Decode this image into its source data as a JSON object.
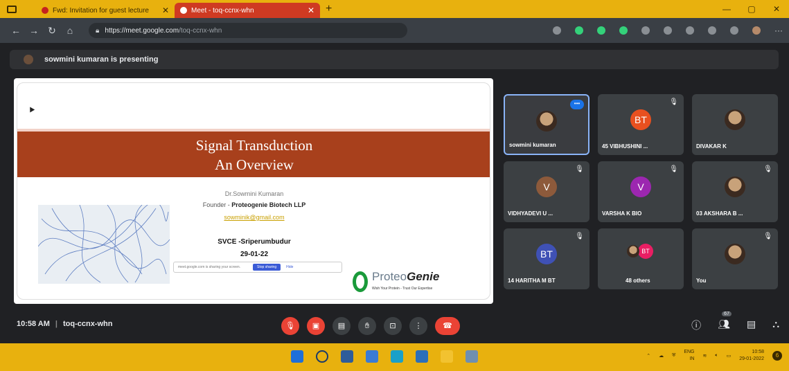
{
  "browser": {
    "tabs": [
      {
        "title": "Fwd: Invitation for guest lecture",
        "active": false
      },
      {
        "title": "Meet - toq-ccnx-whn",
        "active": true
      }
    ],
    "url_domain": "https://meet.google.com",
    "url_path": "/toq-ccnx-whn"
  },
  "meet": {
    "presenting_text": "sowmini kumaran is presenting",
    "meeting_code": "toq-ccnx-whn",
    "time": "10:58 AM"
  },
  "slide": {
    "title_line1": "Signal Transduction",
    "title_line2": "An Overview",
    "author": "Dr.Sowmini Kumaran",
    "founder_prefix": "Founder -",
    "founder_company": "Proteogenie Biotech LLP",
    "email": "sowminik@gmail.com",
    "college": "SVCE -Sriperumbudur",
    "date": "29-01-22",
    "share_text": "meet.google.com is sharing your screen.",
    "stop_sharing": "Stop sharing",
    "hide": "Hide",
    "logo_name_a": "Proteo",
    "logo_name_b": "Genie",
    "logo_tagline": "Wish Your Protein - Trust Our Expertise"
  },
  "participants": [
    {
      "name": "sowmini kumaran",
      "initials": "",
      "avatar_color": "",
      "photo": true
    },
    {
      "name": "45 VIBHUSHINI ...",
      "initials": "BT",
      "avatar_color": "#e8501f"
    },
    {
      "name": "DIVAKAR K",
      "initials": "",
      "avatar_color": "",
      "photo": true
    },
    {
      "name": "VIDHYADEVI U ...",
      "initials": "V",
      "avatar_color": "#8d5a3b"
    },
    {
      "name": "VARSHA K BIO",
      "initials": "V",
      "avatar_color": "#9c27b0"
    },
    {
      "name": "03 AKSHARA B ...",
      "initials": "",
      "avatar_color": "",
      "photo": true
    },
    {
      "name": "14 HARITHA M BT",
      "initials": "BT",
      "avatar_color": "#3f51b5"
    },
    {
      "name": "48 others",
      "initials": "BT",
      "avatar_color": "#e91e63"
    },
    {
      "name": "You",
      "initials": "",
      "avatar_color": "",
      "photo": true
    }
  ],
  "controls": {
    "people_count": "67"
  },
  "taskbar": {
    "lang_line1": "ENG",
    "lang_line2": "IN",
    "clock_time": "10:58",
    "clock_date": "29-01-2022",
    "notification_count": "6"
  },
  "colors": {
    "accent": "#e8b10e",
    "meet_bg": "#202124",
    "danger": "#ea4335",
    "slide_banner": "#a8401c"
  }
}
